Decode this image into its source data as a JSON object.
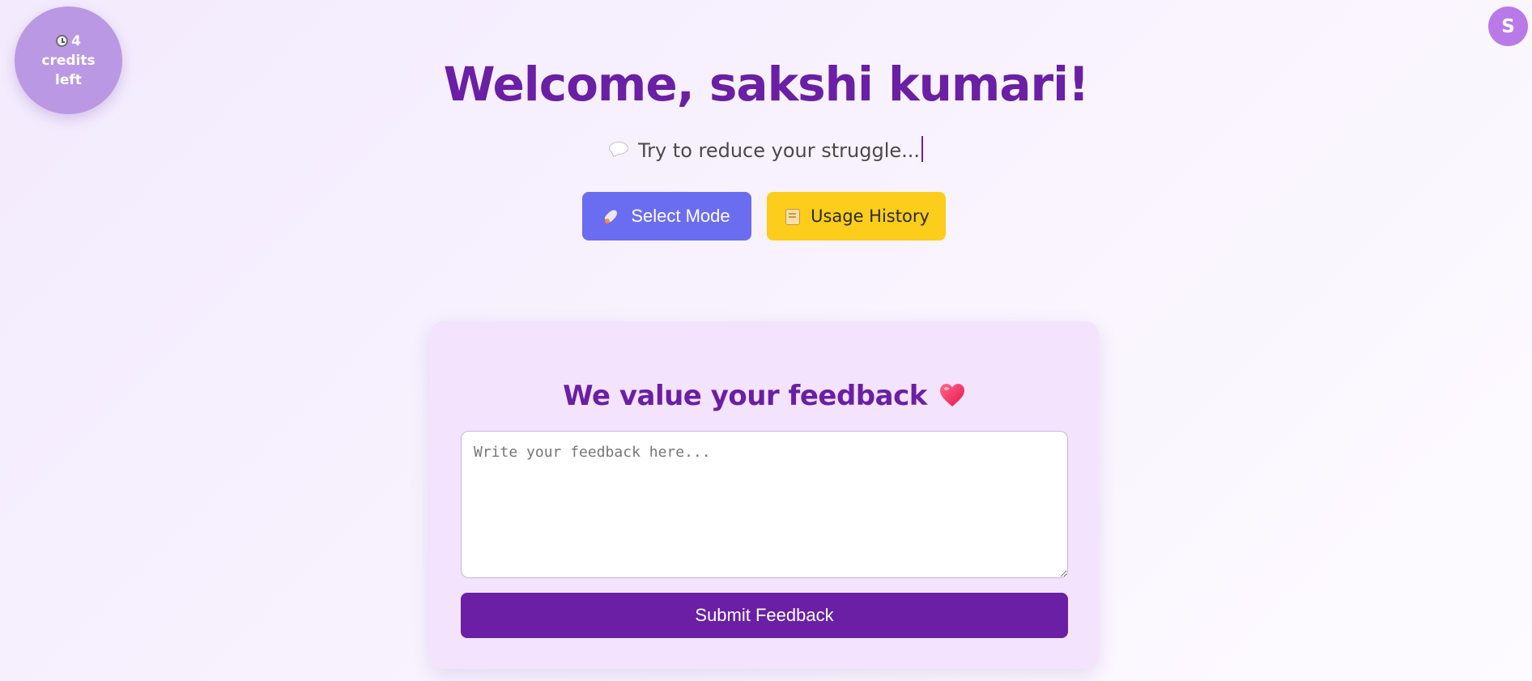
{
  "credits": {
    "icon": "clock-icon",
    "text": "4 credits left"
  },
  "user": {
    "avatar_initial": "S"
  },
  "header": {
    "welcome": "Welcome, sakshi kumari!",
    "tagline_icon": "speech-bubble-icon",
    "tagline": "Try to reduce your struggle..."
  },
  "actions": {
    "select_mode": {
      "icon": "rocket-icon",
      "label": "Select Mode",
      "color": "#6a6df0"
    },
    "usage_history": {
      "icon": "scroll-icon",
      "label": "Usage History",
      "color": "#fccd1b"
    }
  },
  "feedback": {
    "title": "We value your feedback",
    "title_icon": "heart-icon",
    "placeholder": "Write your feedback here...",
    "value": "",
    "submit_label": "Submit Feedback"
  },
  "theme": {
    "primary": "#6a1fa4",
    "badge": "#bb98e3",
    "avatar": "#b97ae8",
    "card": "#f3e3fd"
  }
}
